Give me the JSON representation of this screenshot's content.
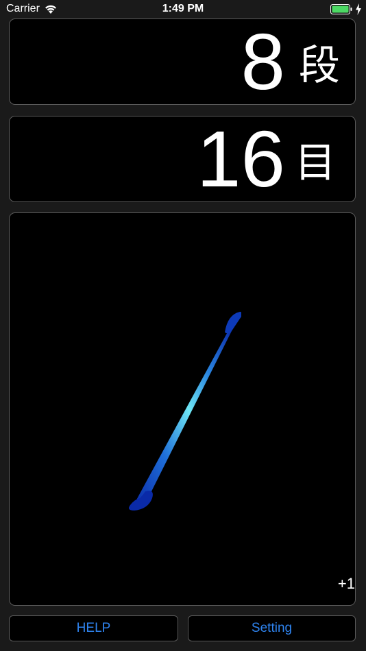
{
  "status_bar": {
    "carrier": "Carrier",
    "time": "1:49 PM"
  },
  "counters": {
    "rows": {
      "value": "8",
      "unit": "段"
    },
    "stitches": {
      "value": "16",
      "unit": "目"
    }
  },
  "tap_area": {
    "icon": "crochet-hook-icon",
    "increment_label": "+1"
  },
  "buttons": {
    "help_label": "HELP",
    "setting_label": "Setting"
  },
  "colors": {
    "accent": "#2f84f0",
    "panel_border": "#5a5a5a",
    "battery": "#4cd964",
    "hook_dark": "#0a2aa8",
    "hook_light": "#6ee6f5"
  }
}
